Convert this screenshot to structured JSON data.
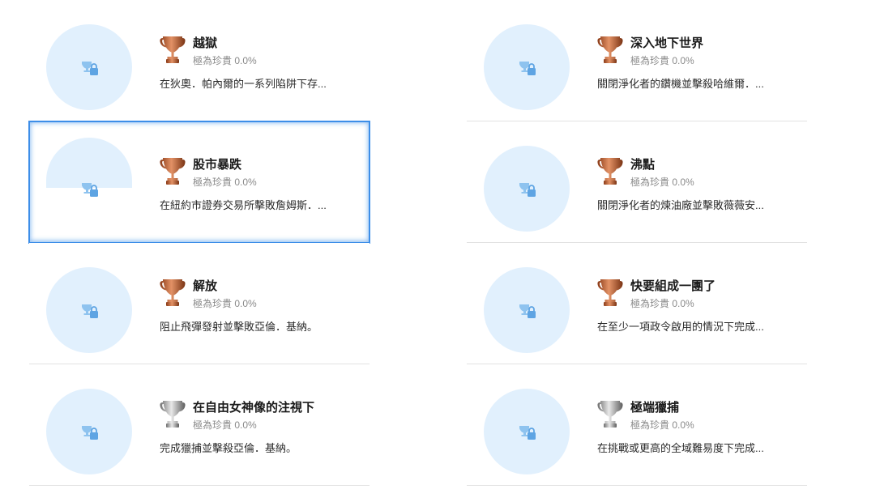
{
  "trophies_left": [
    {
      "title": "越獄",
      "rarity": "極為珍貴 0.0%",
      "description": "在狄奧．帕內爾的一系列陷阱下存...",
      "grade": "bronze"
    },
    {
      "title": "股市暴跌",
      "rarity": "極為珍貴 0.0%",
      "description": "在紐約市證券交易所擊敗詹姆斯．...",
      "grade": "bronze"
    },
    {
      "title": "解放",
      "rarity": "極為珍貴 0.0%",
      "description": "阻止飛彈發射並擊敗亞倫．基納。",
      "grade": "bronze"
    },
    {
      "title": "在自由女神像的注視下",
      "rarity": "極為珍貴 0.0%",
      "description": "完成獵捕並擊殺亞倫．基納。",
      "grade": "silver"
    }
  ],
  "trophies_right": [
    {
      "title": "深入地下世界",
      "rarity": "極為珍貴 0.0%",
      "description": "關閉淨化者的鑽機並擊殺哈維爾．...",
      "grade": "bronze"
    },
    {
      "title": "沸點",
      "rarity": "極為珍貴 0.0%",
      "description": "關閉淨化者的煉油廠並擊敗薇薇安...",
      "grade": "bronze"
    },
    {
      "title": "快要組成一團了",
      "rarity": "極為珍貴 0.0%",
      "description": "在至少一項政令啟用的情況下完成...",
      "grade": "bronze"
    },
    {
      "title": "極端獵捕",
      "rarity": "極為珍貴 0.0%",
      "description": "在挑戰或更高的全域難易度下完成...",
      "grade": "silver"
    }
  ],
  "colors": {
    "bronze": "#c0673a",
    "silver": "#8f8f8f",
    "selection": "#3d8ee8",
    "icon_bg": "#e1f0fd"
  },
  "icons": {
    "locked": "trophy-lock-icon"
  }
}
